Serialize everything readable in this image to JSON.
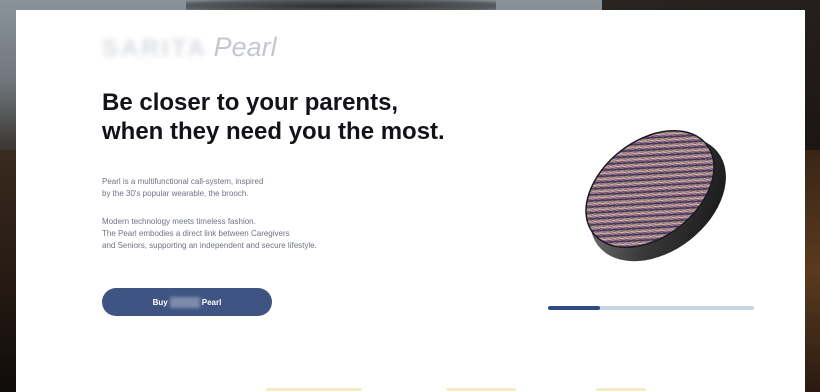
{
  "brand": {
    "logo_text": "SARITA",
    "product_name": "Pearl"
  },
  "hero": {
    "headline_line1": "Be closer to your parents,",
    "headline_line2": "when they need you the most.",
    "paragraph1_line1": "Pearl is a multifunctional call-system, inspired",
    "paragraph1_line2": "by the 30's popular wearable, the brooch.",
    "paragraph2_line1": "Modern technology meets timeless fashion.",
    "paragraph2_line2": "The Pearl embodies a direct link between Caregivers",
    "paragraph2_line3": "and Seniors, supporting an independent and secure lifestyle."
  },
  "buy_button": {
    "prefix": "Buy",
    "suffix": "Pearl"
  },
  "carousel": {
    "progress_fraction": 0.25
  },
  "colors": {
    "accent": "#3f5482",
    "progress_fill": "#2f4c82",
    "progress_track": "#c6d4e6",
    "headline": "#121318"
  },
  "icons": {
    "product_image": "pearl-brooch-icon"
  }
}
